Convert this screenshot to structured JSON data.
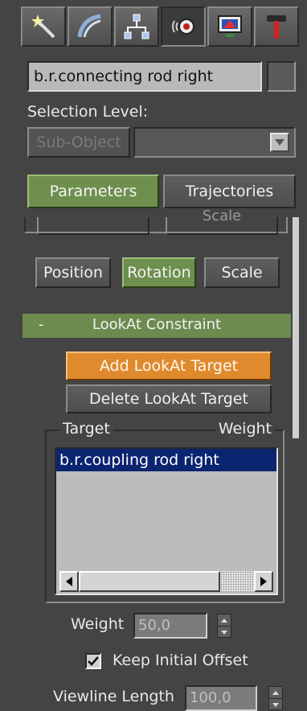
{
  "tabs": [
    {
      "name": "create",
      "icon": "wand-star-icon"
    },
    {
      "name": "modify",
      "icon": "modify-curve-icon"
    },
    {
      "name": "hierarchy",
      "icon": "hierarchy-tree-icon"
    },
    {
      "name": "motion",
      "icon": "motion-icon",
      "active": true
    },
    {
      "name": "display",
      "icon": "display-monitor-icon"
    },
    {
      "name": "utilities",
      "icon": "hammer-icon"
    }
  ],
  "object": {
    "name": "b.r.connecting rod right"
  },
  "selection": {
    "label": "Selection Level:",
    "subobject_button": "Sub-Object"
  },
  "motion_tabs": {
    "parameters": "Parameters",
    "trajectories": "Trajectories"
  },
  "assign": {
    "position": "Position",
    "rotation": "Rotation",
    "scale": "Scale",
    "ghost_label": "Scale"
  },
  "rollout": {
    "toggle": "-",
    "title": "LookAt Constraint"
  },
  "actions": {
    "add_target": "Add LookAt Target",
    "delete_target": "Delete LookAt Target"
  },
  "target_list": {
    "col_target": "Target",
    "col_weight": "Weight",
    "items": [
      "b.r.coupling rod right"
    ]
  },
  "weight": {
    "label": "Weight",
    "value": "50,0"
  },
  "keep_offset": {
    "label": "Keep Initial Offset",
    "checked": true
  },
  "viewline": {
    "label": "Viewline Length",
    "value": "100,0"
  },
  "colors": {
    "background": "#444444",
    "active_green": "#6e8f4e",
    "accent_orange": "#e08a2e",
    "selection_blue": "#0b2470"
  }
}
